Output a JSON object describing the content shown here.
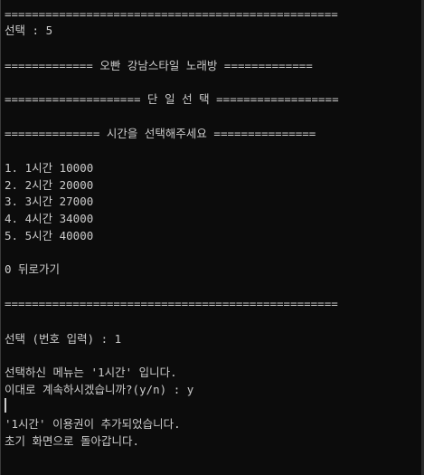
{
  "console": {
    "lines": [
      "=================================================",
      "선택 : 5",
      "",
      "============= 오빤 강남스타일 노래방 =============",
      "",
      "==================== 단 일 선 택 ==================",
      "",
      "============== 시간을 선택해주세요 ===============",
      "",
      "1. 1시간 10000",
      "2. 2시간 20000",
      "3. 3시간 27000",
      "4. 4시간 34000",
      "5. 5시간 40000",
      "",
      "0 뒤로가기",
      "",
      "=================================================",
      "",
      "선택 (번호 입력) : 1",
      "",
      "선택하신 메뉴는 '1시간' 입니다.",
      "이대로 계속하시겠습니까?(y/n) : y",
      "",
      "'1시간' 이용권이 추가되었습니다.",
      "초기 화면으로 돌아갑니다."
    ]
  }
}
